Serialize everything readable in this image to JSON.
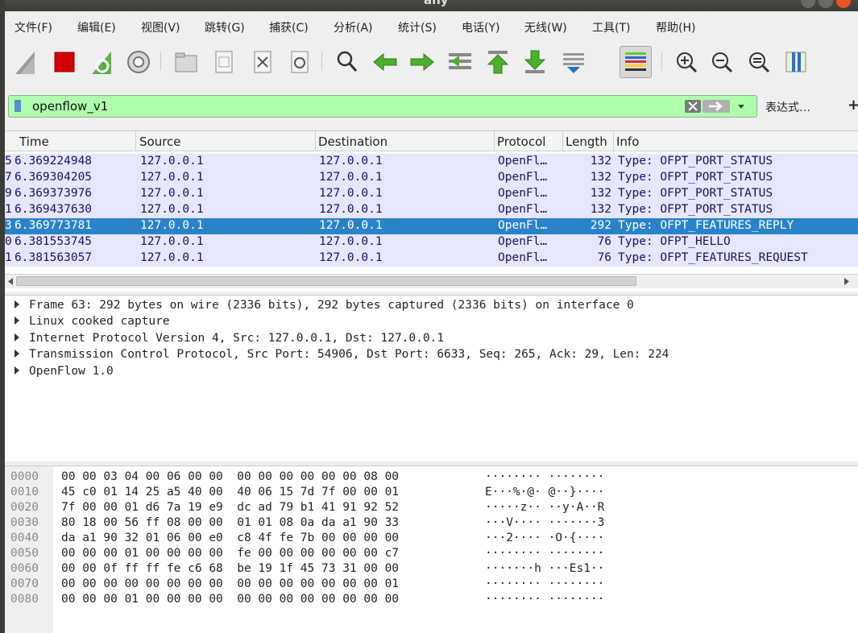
{
  "window": {
    "title": "any"
  },
  "menu": [
    "文件(F)",
    "编辑(E)",
    "视图(V)",
    "跳转(G)",
    "捕获(C)",
    "分析(A)",
    "统计(S)",
    "电话(Y)",
    "无线(W)",
    "工具(T)",
    "帮助(H)"
  ],
  "filter": {
    "value": "openflow_v1",
    "expression_label": "表达式…",
    "add_label": "+"
  },
  "packet_list": {
    "columns": [
      "Time",
      "Source",
      "Destination",
      "Protocol",
      "Length",
      "Info"
    ],
    "rows": [
      {
        "no": "5",
        "time": "6.369224948",
        "source": "127.0.0.1",
        "destination": "127.0.0.1",
        "protocol": "OpenFl…",
        "length": "132",
        "info": "Type: OFPT_PORT_STATUS"
      },
      {
        "no": "7",
        "time": "6.369304205",
        "source": "127.0.0.1",
        "destination": "127.0.0.1",
        "protocol": "OpenFl…",
        "length": "132",
        "info": "Type: OFPT_PORT_STATUS"
      },
      {
        "no": "9",
        "time": "6.369373976",
        "source": "127.0.0.1",
        "destination": "127.0.0.1",
        "protocol": "OpenFl…",
        "length": "132",
        "info": "Type: OFPT_PORT_STATUS"
      },
      {
        "no": "1",
        "time": "6.369437630",
        "source": "127.0.0.1",
        "destination": "127.0.0.1",
        "protocol": "OpenFl…",
        "length": "132",
        "info": "Type: OFPT_PORT_STATUS"
      },
      {
        "no": "3",
        "time": "6.369773781",
        "source": "127.0.0.1",
        "destination": "127.0.0.1",
        "protocol": "OpenFl…",
        "length": "292",
        "info": "Type: OFPT_FEATURES_REPLY",
        "selected": true
      },
      {
        "no": "0",
        "time": "6.381553745",
        "source": "127.0.0.1",
        "destination": "127.0.0.1",
        "protocol": "OpenFl…",
        "length": "76",
        "info": "Type: OFPT_HELLO"
      },
      {
        "no": "1",
        "time": "6.381563057",
        "source": "127.0.0.1",
        "destination": "127.0.0.1",
        "protocol": "OpenFl…",
        "length": "76",
        "info": "Type: OFPT_FEATURES_REQUEST"
      }
    ]
  },
  "details": [
    "Frame 63: 292 bytes on wire (2336 bits), 292 bytes captured (2336 bits) on interface 0",
    "Linux cooked capture",
    "Internet Protocol Version 4, Src: 127.0.0.1, Dst: 127.0.0.1",
    "Transmission Control Protocol, Src Port: 54906, Dst Port: 6633, Seq: 265, Ack: 29, Len: 224",
    "OpenFlow 1.0"
  ],
  "hex": [
    {
      "offset": "0000",
      "bytes": "00 00 03 04 00 06 00 00  00 00 00 00 00 00 08 00",
      "ascii": "········ ········"
    },
    {
      "offset": "0010",
      "bytes": "45 c0 01 14 25 a5 40 00  40 06 15 7d 7f 00 00 01",
      "ascii": "E···%·@· @··}····"
    },
    {
      "offset": "0020",
      "bytes": "7f 00 00 01 d6 7a 19 e9  dc ad 79 b1 41 91 92 52",
      "ascii": "·····z·· ··y·A··R"
    },
    {
      "offset": "0030",
      "bytes": "80 18 00 56 ff 08 00 00  01 01 08 0a da a1 90 33",
      "ascii": "···V···· ·······3"
    },
    {
      "offset": "0040",
      "bytes": "da a1 90 32 01 06 00 e0  c8 4f fe 7b 00 00 00 00",
      "ascii": "···2···· ·O·{····"
    },
    {
      "offset": "0050",
      "bytes": "00 00 00 01 00 00 00 00  fe 00 00 00 00 00 00 c7",
      "ascii": "········ ········"
    },
    {
      "offset": "0060",
      "bytes": "00 00 0f ff ff fe c6 68  be 19 1f 45 73 31 00 00",
      "ascii": "·······h ···Es1··"
    },
    {
      "offset": "0070",
      "bytes": "00 00 00 00 00 00 00 00  00 00 00 00 00 00 00 01",
      "ascii": "········ ········"
    },
    {
      "offset": "0080",
      "bytes": "00 00 00 01 00 00 00 00  00 00 00 00 00 00 00 00",
      "ascii": "········ ········"
    }
  ],
  "colors": {
    "filter_valid": "#afffaf",
    "row_bg": "#e7e6ff",
    "row_selected": "#2a83c9",
    "row_text": "#15155c"
  }
}
